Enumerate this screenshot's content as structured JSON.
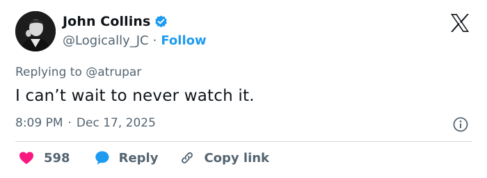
{
  "author": {
    "name": "John Collins",
    "handle": "@Logically_JC",
    "separator": "·",
    "follow_label": "Follow",
    "verified_icon": "verified-badge-icon",
    "avatar": "profile-photo"
  },
  "brand": {
    "logo_icon": "x-logo-icon"
  },
  "tweet": {
    "reply_prefix": "Replying to",
    "reply_handle": "@atrupar",
    "text": "I can’t wait to never watch it.",
    "time": "8:09 PM",
    "separator": "·",
    "date": "Dec 17, 2025",
    "info_icon": "info-icon"
  },
  "actions": {
    "like_count": "598",
    "like_icon": "heart-icon",
    "reply_label": "Reply",
    "reply_icon": "speech-bubble-icon",
    "copy_label": "Copy link",
    "copy_icon": "link-icon"
  },
  "colors": {
    "accent": "#1d9bf0",
    "text_primary": "#0f1419",
    "text_secondary": "#536471",
    "like": "#f91880",
    "divider": "#cfd9de"
  }
}
